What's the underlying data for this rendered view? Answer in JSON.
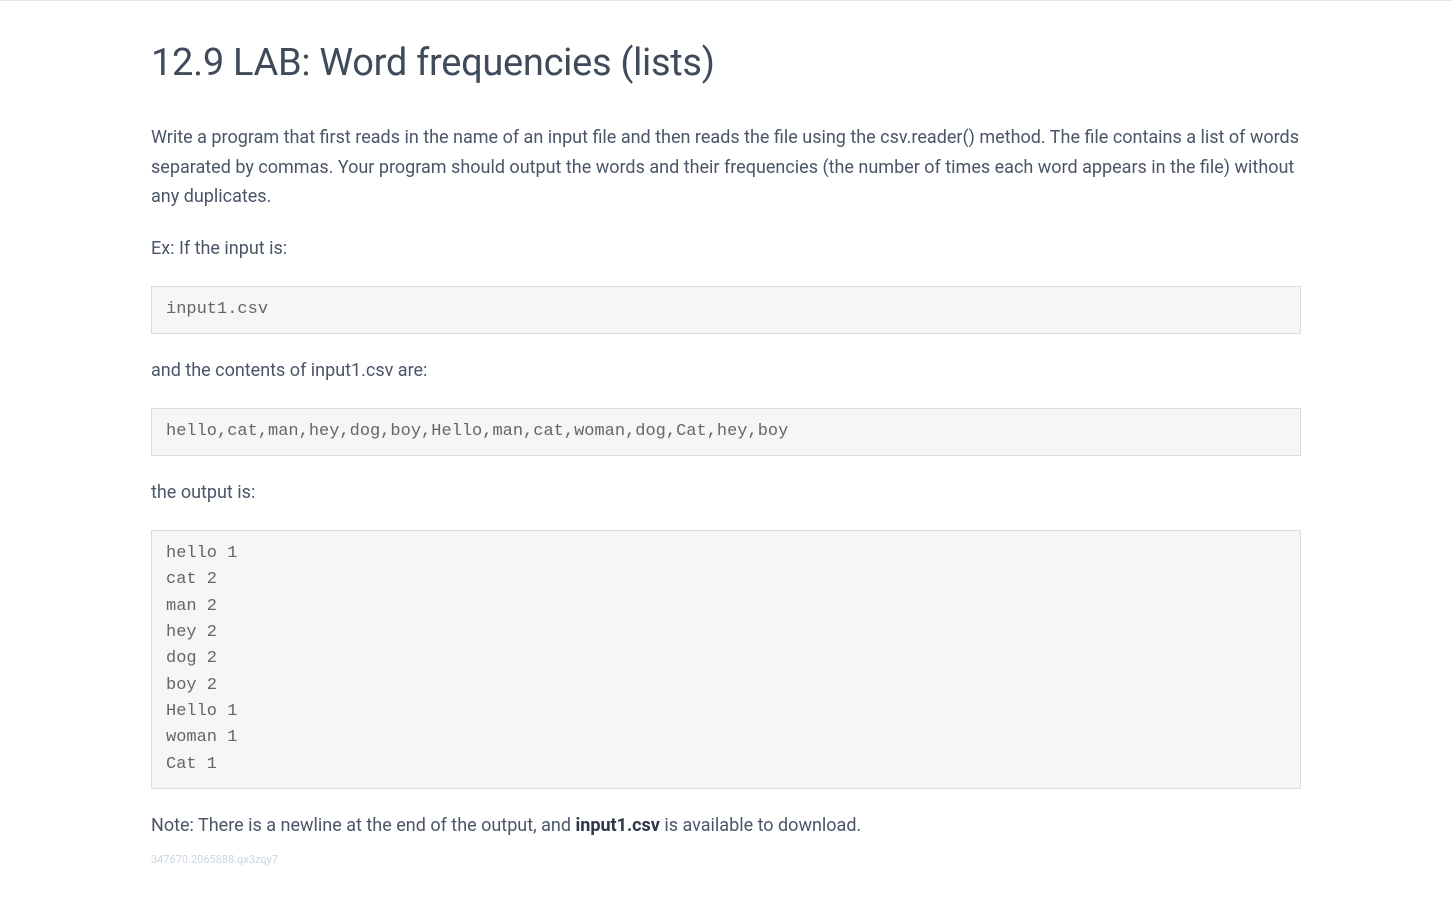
{
  "title": "12.9 LAB: Word frequencies (lists)",
  "intro": "Write a program that first reads in the name of an input file and then reads the file using the csv.reader() method. The file contains a list of words separated by commas. Your program should output the words and their frequencies (the number of times each word appears in the file) without any duplicates.",
  "example_input_label": "Ex: If the input is:",
  "example_input": "input1.csv",
  "contents_label": "and the contents of input1.csv are:",
  "contents_code": "hello,cat,man,hey,dog,boy,Hello,man,cat,woman,dog,Cat,hey,boy",
  "output_label": "the output is:",
  "output_code": "hello 1\ncat 2\nman 2\nhey 2\ndog 2\nboy 2\nHello 1\nwoman 1\nCat 1",
  "note_prefix": "Note: There is a newline at the end of the output, and ",
  "note_filename": "input1.csv",
  "note_suffix": " is available to download.",
  "footer_id": "347670.2065888.qx3zqy7"
}
